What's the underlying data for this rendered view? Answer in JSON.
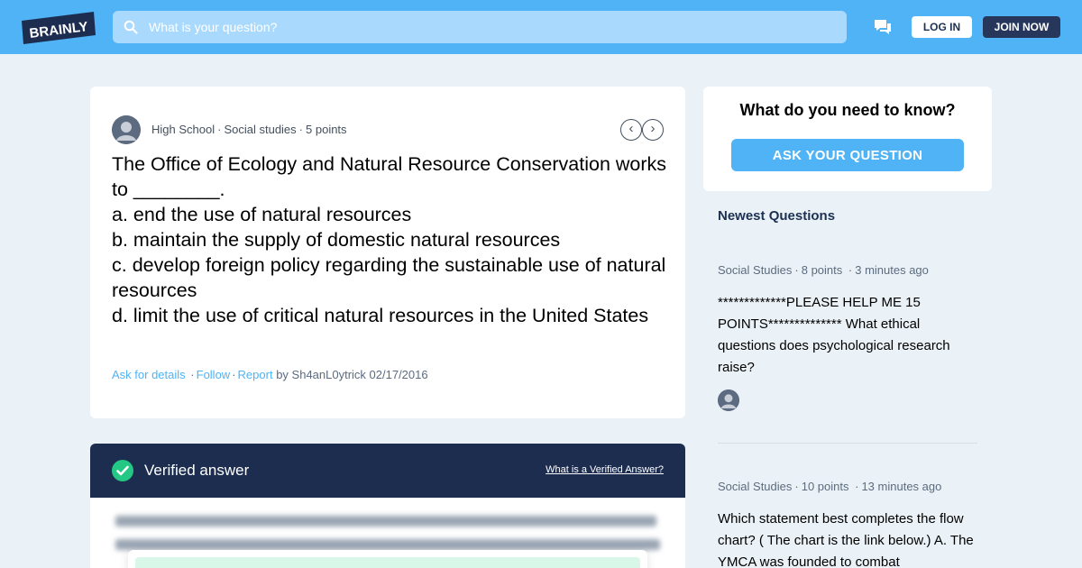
{
  "header": {
    "brand": "BRAINLY",
    "search_placeholder": "What is your question?",
    "login_label": "LOG IN",
    "join_label": "JOIN NOW",
    "icons": {
      "search": "search-icon",
      "messages": "chat-bubble-icon"
    }
  },
  "question": {
    "grade": "High School",
    "subject": "Social studies",
    "points": "5 points",
    "text": "The Office of Ecology and Natural Resource Conservation works to ________.\na. end the use of natural resources\nb. maintain the supply of domestic natural resources\nc. develop foreign policy regarding the sustainable use of natural resources\nd. limit the use of critical natural resources in the United States",
    "actions": {
      "ask_details": "Ask for details",
      "follow": "Follow",
      "report": "Report"
    },
    "author_line": "by Sh4anL0ytrick 02/17/2016",
    "nav": {
      "prev": "‹",
      "next": "›"
    }
  },
  "verified": {
    "title": "Verified answer",
    "link": "What is a Verified Answer?"
  },
  "sidebar": {
    "ask_title": "What do you need to know?",
    "ask_button": "ASK YOUR QUESTION",
    "newest_title": "Newest Questions",
    "questions": [
      {
        "subject": "Social Studies",
        "points": "8 points",
        "time": "3 minutes ago",
        "text": "*************PLEASE HELP ME 15 POINTS************** What ethical questions does psychological research raise?"
      },
      {
        "subject": "Social Studies",
        "points": "10 points",
        "time": "13 minutes ago",
        "text": "Which statement best completes the flow chart? ( The chart is the link below.) A. The YMCA was founded to combat"
      }
    ]
  },
  "colors": {
    "brand_blue": "#4fb3f6",
    "navy": "#1c2d50",
    "join_bg": "#27375b",
    "verified_green": "#24c784"
  }
}
